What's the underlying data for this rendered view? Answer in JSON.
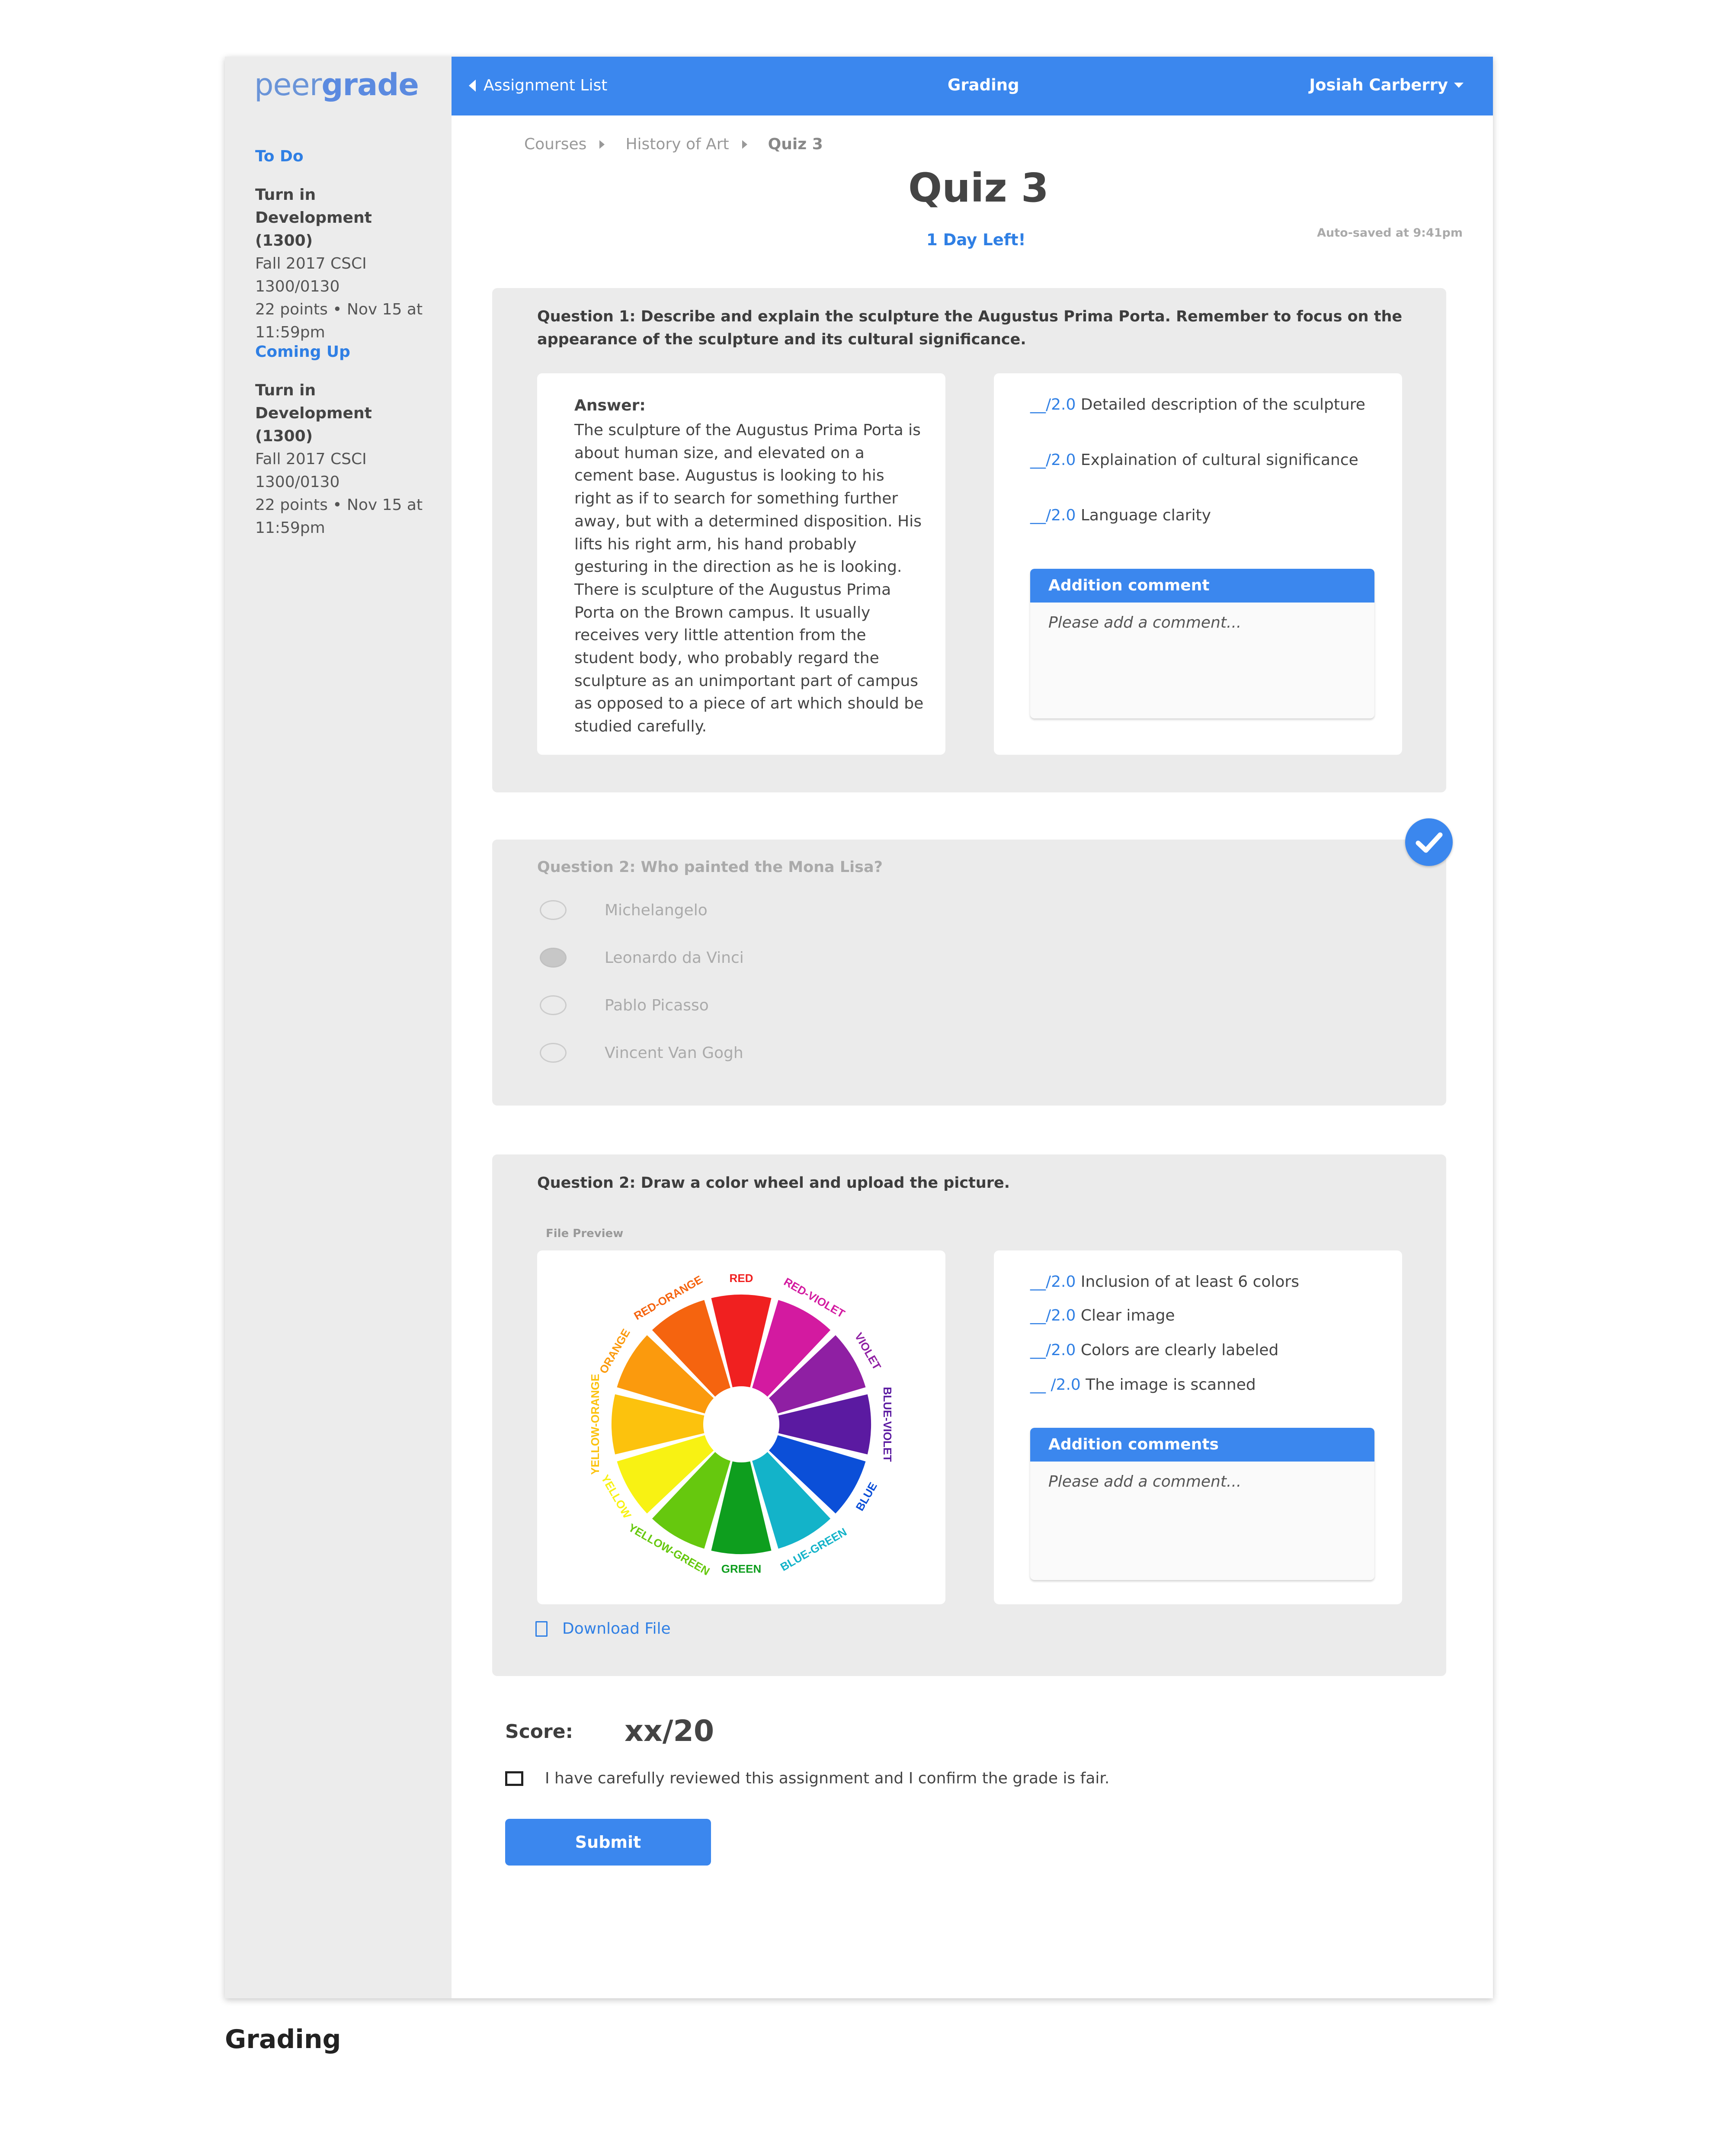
{
  "brand": {
    "logo_prefix": "peer",
    "logo_suffix": "grade"
  },
  "sidebar": {
    "todo": {
      "heading": "To Do",
      "title_line1": "Turn in Development",
      "title_line2": "(1300)",
      "lines": [
        "Fall 2017 CSCI",
        "1300/0130",
        "22 points • Nov 15 at",
        "11:59pm"
      ]
    },
    "coming_up": {
      "heading": "Coming Up",
      "title_line1": "Turn in Development",
      "title_line2": "(1300)",
      "lines": [
        "Fall 2017 CSCI",
        "1300/0130",
        "22 points • Nov 15 at",
        "11:59pm"
      ]
    }
  },
  "topbar": {
    "back_label": "Assignment List",
    "title": "Grading",
    "user": "Josiah Carberry"
  },
  "breadcrumb": [
    "Courses",
    "History of Art",
    "Quiz 3"
  ],
  "page": {
    "title": "Quiz 3",
    "deadline": "1 Day Left!",
    "autosave": "Auto-saved at 9:41pm"
  },
  "q1": {
    "text": "Question 1: Describe and explain the sculpture the Augustus Prima Porta. Remember to focus on the appearance of the sculpture and its cultural significance.",
    "answer_label": "Answer:",
    "answer": "The sculpture of the Augustus Prima Porta is about human size, and elevated on a cement base. Augustus is looking to his right as if to search for something further away, but with a determined disposition. His lifts his right arm, his hand probably gesturing in the direction as he is looking. There is sculpture of the Augustus Prima Porta on the Brown campus. It usually receives very little attention from the student body, who probably regard the sculpture as an unimportant part of campus as opposed to a piece of art which should be studied carefully.",
    "rubric": [
      {
        "score": "__/2.0",
        "label": "Detailed description of the sculpture"
      },
      {
        "score": "__/2.0",
        "label": "Explaination of cultural significance"
      },
      {
        "score": "__/2.0",
        "label": "Language clarity"
      }
    ],
    "comment_header": "Addition comment",
    "comment_placeholder": "Please add a comment..."
  },
  "q2": {
    "text": "Question 2: Who painted the Mona Lisa?",
    "options": [
      "Michelangelo",
      "Leonardo da Vinci",
      "Pablo Picasso",
      "Vincent Van Gogh"
    ],
    "selected_index": 1,
    "status_icon": "checkmark-circle-icon"
  },
  "q3": {
    "text": "Question 2: Draw a color wheel and upload the picture.",
    "file_preview_label": "File Preview",
    "wheel_labels": [
      "RED",
      "RED-VIOLET",
      "VIOLET",
      "BLUE-VIOLET",
      "BLUE",
      "BLUE-GREEN",
      "GREEN",
      "YELLOW-GREEN",
      "YELLOW",
      "YELLOW-ORANGE",
      "ORANGE",
      "RED-ORANGE"
    ],
    "wheel_colors": [
      "#f02020",
      "#d31aa0",
      "#8f1fa3",
      "#5b1aa1",
      "#0b4fd8",
      "#13b3c9",
      "#0e9e1e",
      "#66c80e",
      "#f8f213",
      "#fcc20d",
      "#fb9a0d",
      "#f5640f"
    ],
    "rubric": [
      {
        "score": "__/2.0",
        "label": "Inclusion of at least 6 colors"
      },
      {
        "score": "__/2.0",
        "label": "Clear image"
      },
      {
        "score": "__/2.0",
        "label": "Colors are clearly labeled"
      },
      {
        "score": "__ /2.0",
        "label": "The image is scanned"
      }
    ],
    "comment_header": "Addition comments",
    "comment_placeholder": "Please add a comment...",
    "download_label": "Download File"
  },
  "footer": {
    "score_label": "Score:",
    "score_value": "xx/20",
    "confirm_text": "I have carefully reviewed this assignment and I confirm the grade is fair.",
    "submit_label": "Submit"
  },
  "caption": "Grading",
  "colors": {
    "accent": "#3b87ee",
    "link": "#2f7fe4",
    "sidebar_bg": "#ececec",
    "card_bg": "#ebebeb"
  }
}
